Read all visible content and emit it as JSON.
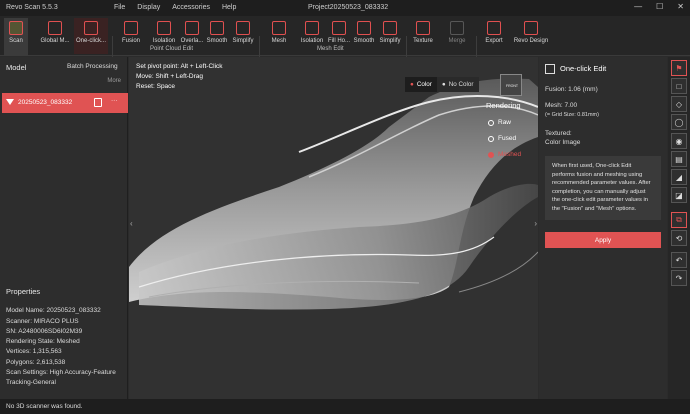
{
  "window": {
    "app": "Revo Scan 5.5.3",
    "project": "Project20250523_083332",
    "menu": [
      "File",
      "Display",
      "Accessories",
      "Help"
    ],
    "controls": [
      "—",
      "☐",
      "✕"
    ]
  },
  "ribbon": {
    "buttons": [
      {
        "label": "Scan"
      },
      {
        "label": "Global M..."
      },
      {
        "label": "One-click..."
      },
      {
        "label": "Fusion"
      },
      {
        "label": "Isolation"
      },
      {
        "label": "Overla..."
      },
      {
        "label": "Smooth"
      },
      {
        "label": "Simplify"
      },
      {
        "label": "Mesh"
      },
      {
        "label": "Isolation"
      },
      {
        "label": "Fill Ho..."
      },
      {
        "label": "Smooth"
      },
      {
        "label": "Simplify"
      },
      {
        "label": "Texture"
      },
      {
        "label": "Merge"
      },
      {
        "label": "Export"
      },
      {
        "label": "Revo Design"
      }
    ],
    "groups": {
      "point_cloud": "Point Cloud Edit",
      "mesh": "Mesh Edit"
    }
  },
  "left": {
    "title": "Model",
    "batch": "Batch Processing",
    "more": "More",
    "item": {
      "name": "20250523_083332",
      "menu": "···"
    },
    "properties": {
      "title": "Properties",
      "lines": [
        "Model Name:  20250523_083332",
        "Scanner:  MIRACO PLUS",
        "SN:  A2480006SD6I02M39",
        "Rendering State:  Meshed",
        "Vertices:  1,315,563",
        "Polygons:  2,613,538",
        "Scan Settings:  High Accuracy-Feature",
        "Tracking-General"
      ]
    }
  },
  "viewport": {
    "hints": [
      {
        "label": "Set pivot point:",
        "value": "Alt + Left-Click"
      },
      {
        "label": "Move:",
        "value": "Shift + Left-Drag"
      },
      {
        "label": "Reset:",
        "value": "Space"
      }
    ],
    "color_on": "Color",
    "color_off": "No Color",
    "cube": "FRONT",
    "rendering": {
      "title": "Rendering",
      "options": [
        "Raw",
        "Fused",
        "Meshed"
      ],
      "selected": 2
    }
  },
  "right": {
    "title": "One-click Edit",
    "fusion": "Fusion:  1.06 (mm)",
    "mesh": "Mesh:  7.00",
    "grid": "(= Grid Size: 0.81mm)",
    "textured": "Textured:",
    "color_image": "Color Image",
    "note": "When first used, One-click Edit performs fusion and meshing using recommended parameter values. After completion, you can manually adjust the one-click edit parameter values in the \"Fusion\" and \"Mesh\" options.",
    "apply": "Apply"
  },
  "tools": [
    "⚑",
    "□",
    "◇",
    "◯",
    "◉",
    "▤",
    "◢",
    "◪",
    "⧉",
    "⟲",
    "↶",
    "↷"
  ],
  "status": "No 3D scanner was found.",
  "colors": {
    "accent": "#e05353",
    "panel": "#2d2d2d",
    "viewport": "#313131"
  }
}
